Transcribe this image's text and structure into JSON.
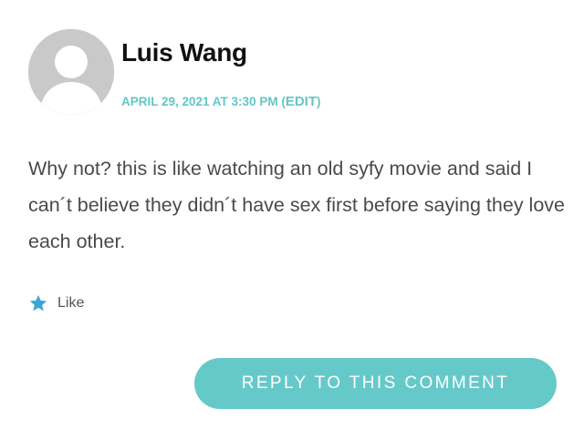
{
  "comment": {
    "author_name": "Luis Wang",
    "timestamp": "APRIL 29, 2021 AT 3:30 PM",
    "edit_open": "(",
    "edit_label": "EDIT",
    "edit_close": ")",
    "body": "Why not? this is like watching an old syfy movie and said I can´t believe they didn´t have sex first before saying they love each other.",
    "like_label": "Like",
    "reply_label": "REPLY TO THIS COMMENT"
  },
  "colors": {
    "accent": "#66c9c9",
    "author": "#111111",
    "body_text": "#4a4a4a",
    "avatar_bg": "#c9c9c9",
    "like_star": "#3fa6d3"
  },
  "icons": {
    "avatar": "default-avatar-icon",
    "like": "star-icon"
  }
}
